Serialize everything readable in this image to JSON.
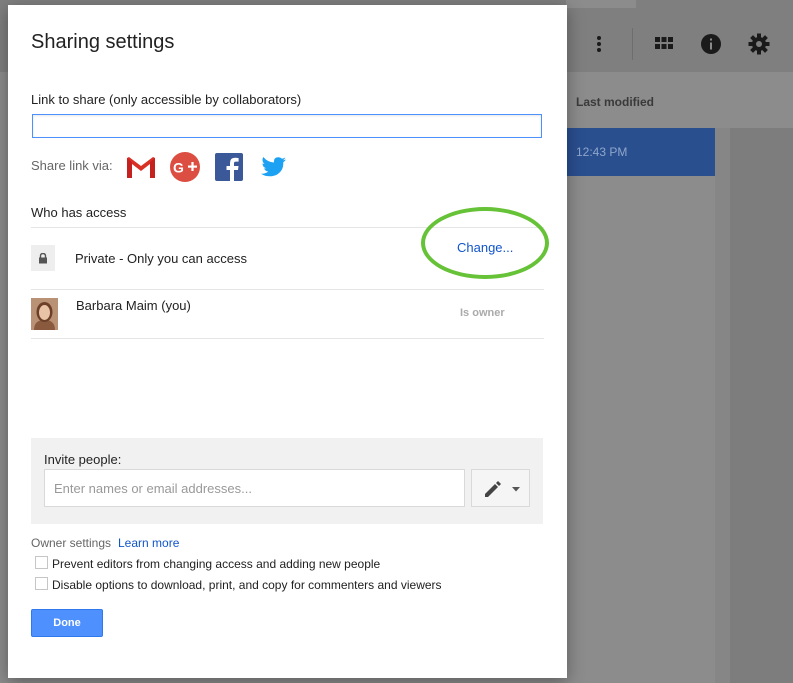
{
  "background": {
    "column_header": "Last modified",
    "selected_row_time": "12:43 PM",
    "icons": [
      "more-vert-icon",
      "grid-view-icon",
      "info-icon",
      "settings-icon"
    ]
  },
  "dialog": {
    "title": "Sharing settings",
    "link_label": "Link to share (only accessible by collaborators)",
    "link_value": "",
    "share_via_label": "Share link via:",
    "share_targets": [
      "gmail-icon",
      "google-plus-icon",
      "facebook-icon",
      "twitter-icon"
    ],
    "who_has_access_label": "Who has access",
    "access": {
      "level_text": "Private - Only you can access",
      "change_link": "Change..."
    },
    "owner": {
      "name": "Barbara Maim (you)",
      "role": "Is owner"
    },
    "invite": {
      "label": "Invite people:",
      "placeholder": "Enter names or email addresses..."
    },
    "owner_settings": {
      "label": "Owner settings",
      "learn_more": "Learn more",
      "options": [
        {
          "label": "Prevent editors from changing access and adding new people",
          "checked": false
        },
        {
          "label": "Disable options to download, print, and copy for commenters and viewers",
          "checked": false
        }
      ]
    },
    "done_label": "Done"
  },
  "colors": {
    "accent_blue": "#4d90fe",
    "link_blue": "#1155cc",
    "highlight_green": "#66c236"
  }
}
